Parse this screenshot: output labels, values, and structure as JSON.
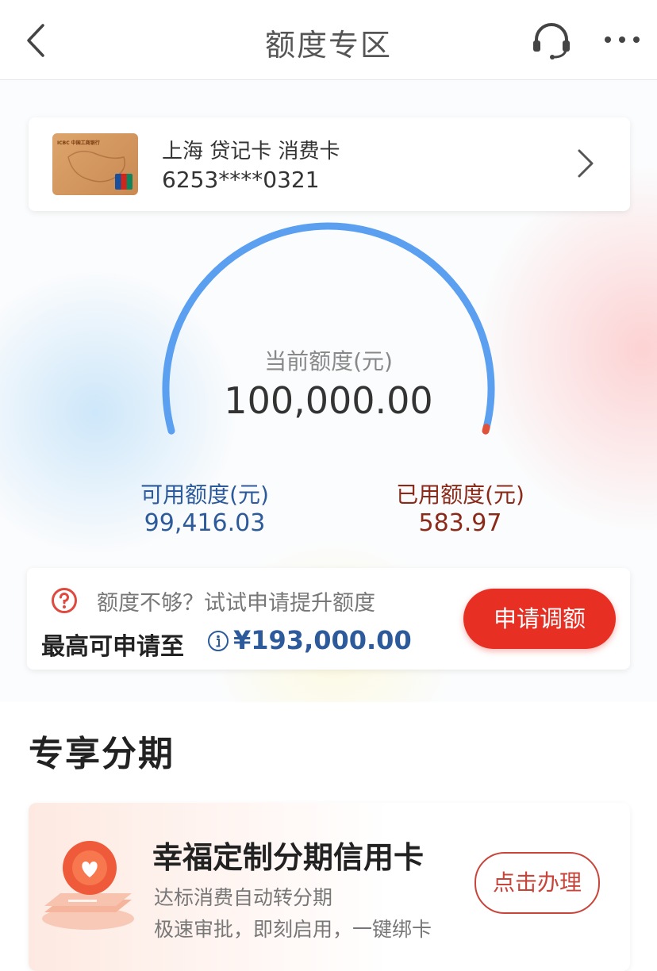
{
  "header": {
    "title": "额度专区",
    "back_icon": "chevron-left-icon",
    "service_icon": "headset-icon",
    "more_icon": "more-dots-icon"
  },
  "card": {
    "name": "上海 贷记卡 消费卡",
    "number": "6253****0321",
    "thumb_brand": "ICBC 中国工商银行"
  },
  "limit": {
    "current_label": "当前额度(元)",
    "current_value": "100,000.00",
    "available_label": "可用额度(元)",
    "available_value": "99,416.03",
    "used_label": "已用额度(元)",
    "used_value": "583.97",
    "used_fraction": 0.0058,
    "colors": {
      "gauge": "#5a9ff0",
      "used": "#e0523a",
      "available_text": "#2c5a9a",
      "used_text": "#8c2a1a"
    }
  },
  "raise": {
    "hint": "额度不够？试试申请提升额度",
    "prefix": "最高可申请至",
    "amount": "¥193,000.00",
    "button": "申请调额"
  },
  "section": {
    "title": "专享分期"
  },
  "promo": {
    "title": "幸福定制分期信用卡",
    "sub1": "达标消费自动转分期",
    "sub2": "极速审批，即刻启用，一键绑卡",
    "button": "点击办理"
  }
}
